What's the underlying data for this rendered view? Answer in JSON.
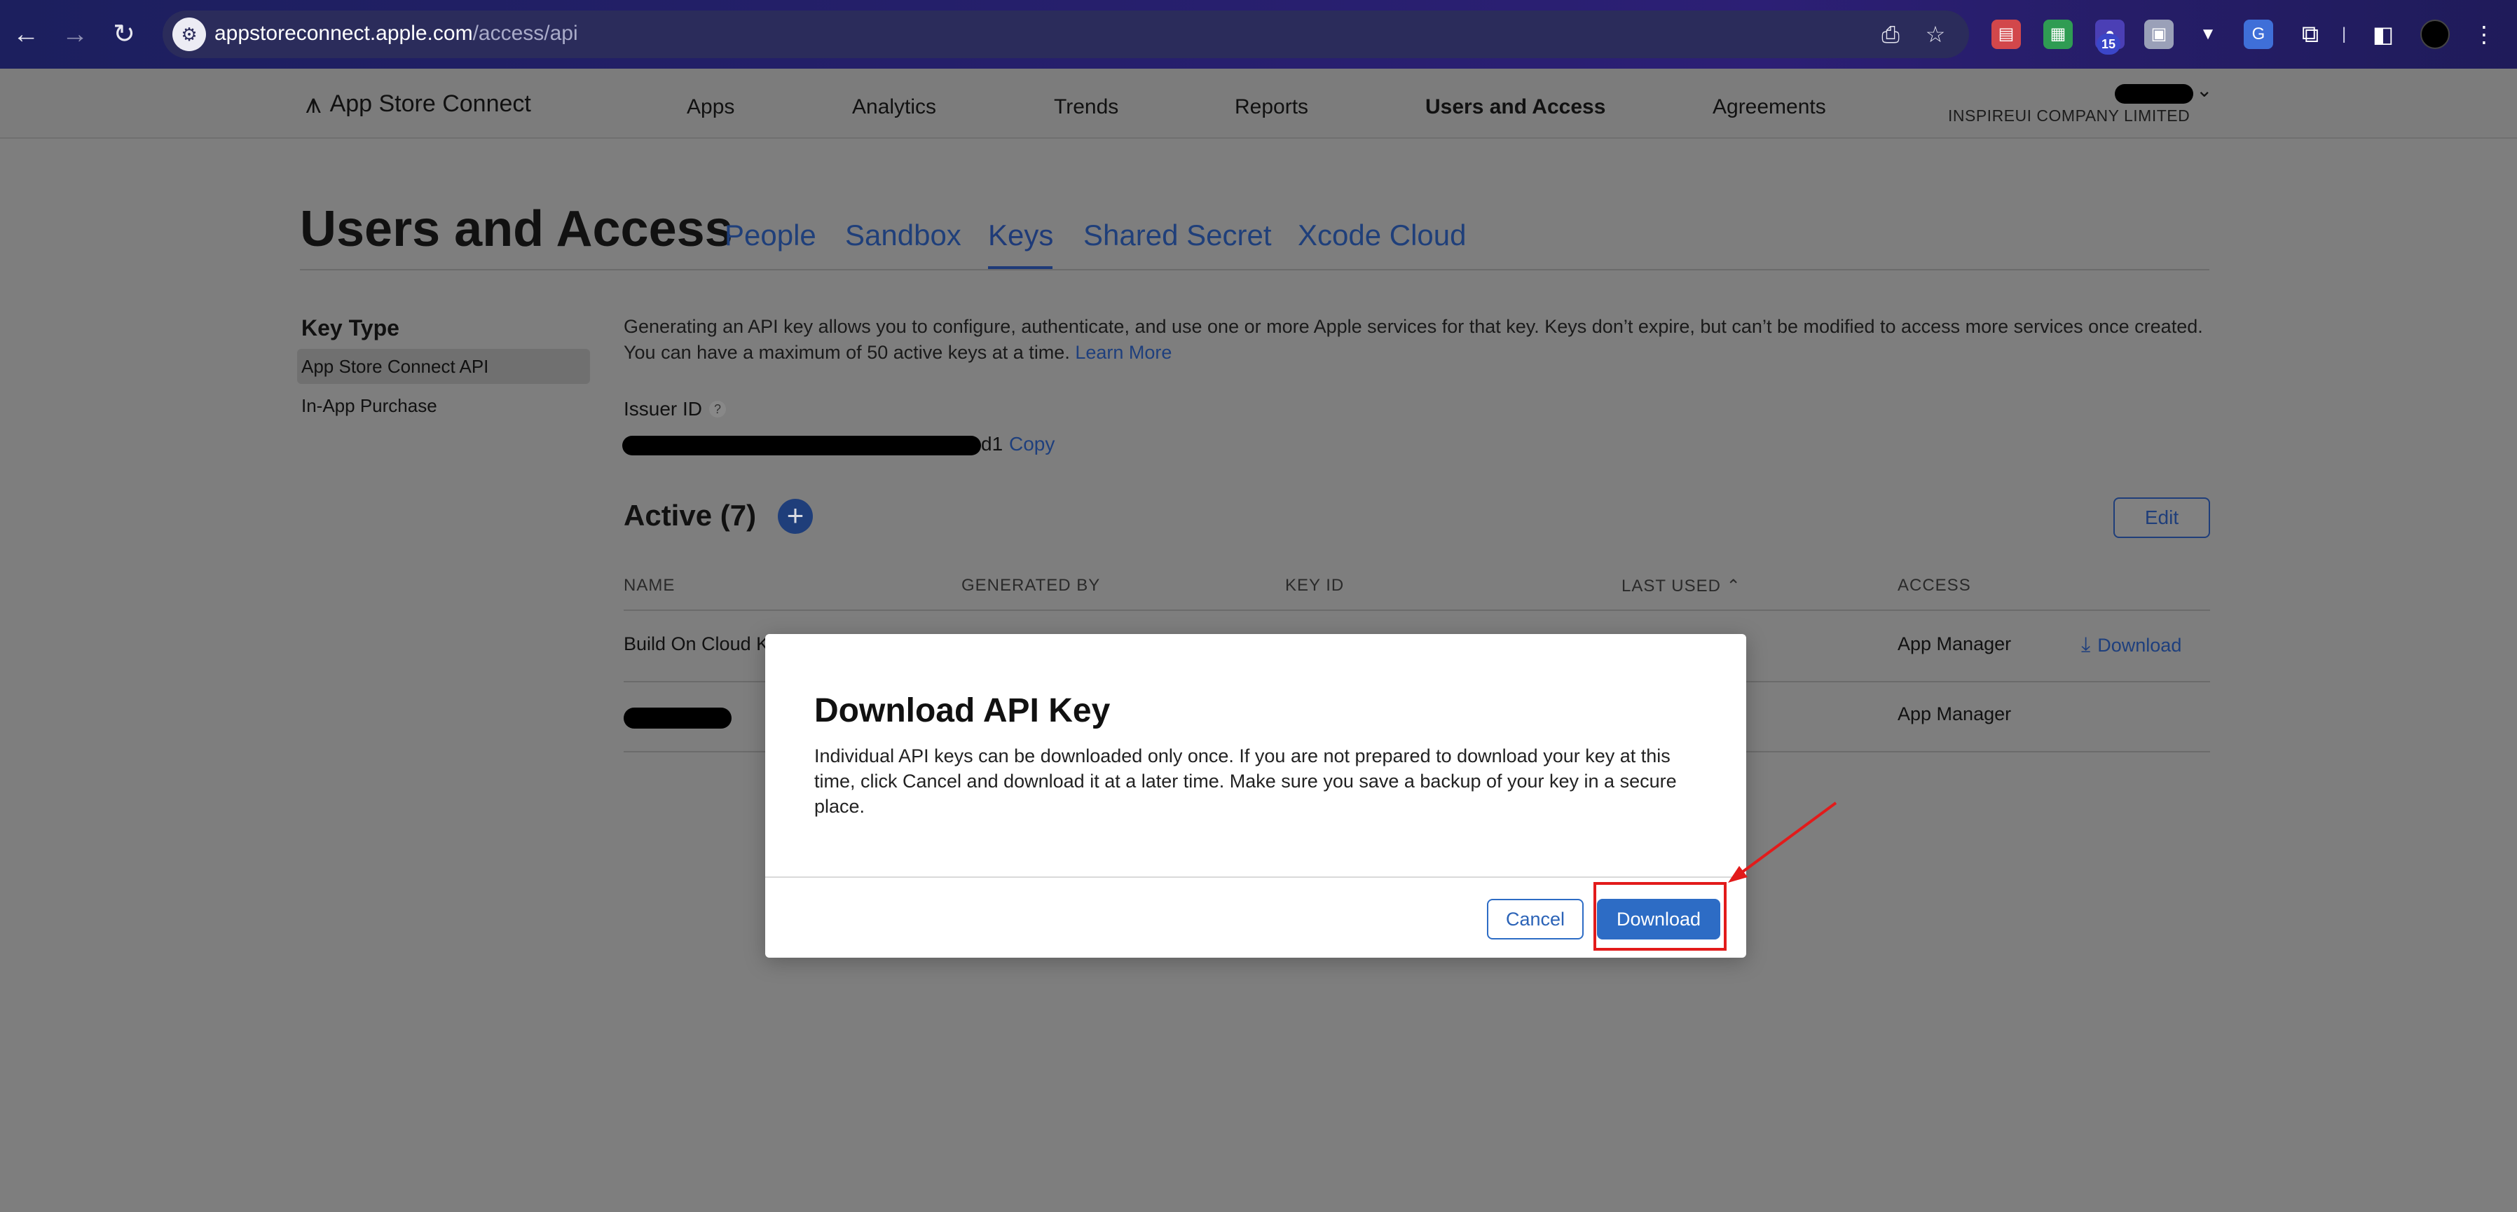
{
  "browser": {
    "url_host": "appstoreconnect.apple.com",
    "url_path": "/access/api",
    "extension_badge": "15"
  },
  "header": {
    "brand": "App Store Connect",
    "nav": [
      "Apps",
      "Analytics",
      "Trends",
      "Reports",
      "Users and Access",
      "Agreements"
    ],
    "active_nav": "Users and Access",
    "org_name": "INSPIREUI COMPANY LIMITED"
  },
  "page": {
    "title": "Users and Access",
    "tabs": [
      "People",
      "Sandbox",
      "Keys",
      "Shared Secret",
      "Xcode Cloud"
    ],
    "active_tab": "Keys"
  },
  "sidebar": {
    "heading": "Key Type",
    "items": [
      "App Store Connect API",
      "In-App Purchase"
    ],
    "selected": "App Store Connect API"
  },
  "content": {
    "intro": "Generating an API key allows you to configure, authenticate, and use one or more Apple services for that key. Keys don’t expire, but can’t be modified to access more services once created. You can have a maximum of 50 active keys at a time.",
    "learn_more": "Learn More",
    "issuer_label": "Issuer ID",
    "issuer_help": "?",
    "issuer_suffix": "d1",
    "copy": "Copy",
    "active_title": "Active (7)",
    "edit": "Edit"
  },
  "table": {
    "columns": [
      "NAME",
      "GENERATED BY",
      "KEY ID",
      "LAST USED",
      "ACCESS"
    ],
    "sort_indicator": "⌃",
    "rows": [
      {
        "name": "Build On Cloud K",
        "access": "App Manager",
        "action": "Download"
      },
      {
        "name": "",
        "access": "App Manager",
        "action": ""
      }
    ]
  },
  "modal": {
    "title": "Download API Key",
    "body": "Individual API keys can be downloaded only once. If you are not prepared to download your key at this time, click Cancel and download it at a later time. Make sure you save a backup of your key in a secure place.",
    "cancel": "Cancel",
    "confirm": "Download"
  },
  "colors": {
    "accent": "#2d6cc5",
    "annotation": "#e21b1b",
    "chrome_bg": "#251f6b"
  },
  "icons": {
    "back": "arrow-left-icon",
    "forward": "arrow-right-icon",
    "reload": "reload-icon",
    "site": "site-settings-icon",
    "install": "install-app-icon",
    "bookmark": "star-icon",
    "logo": "app-store-logo-icon",
    "add": "plus-icon",
    "download": "download-icon"
  }
}
